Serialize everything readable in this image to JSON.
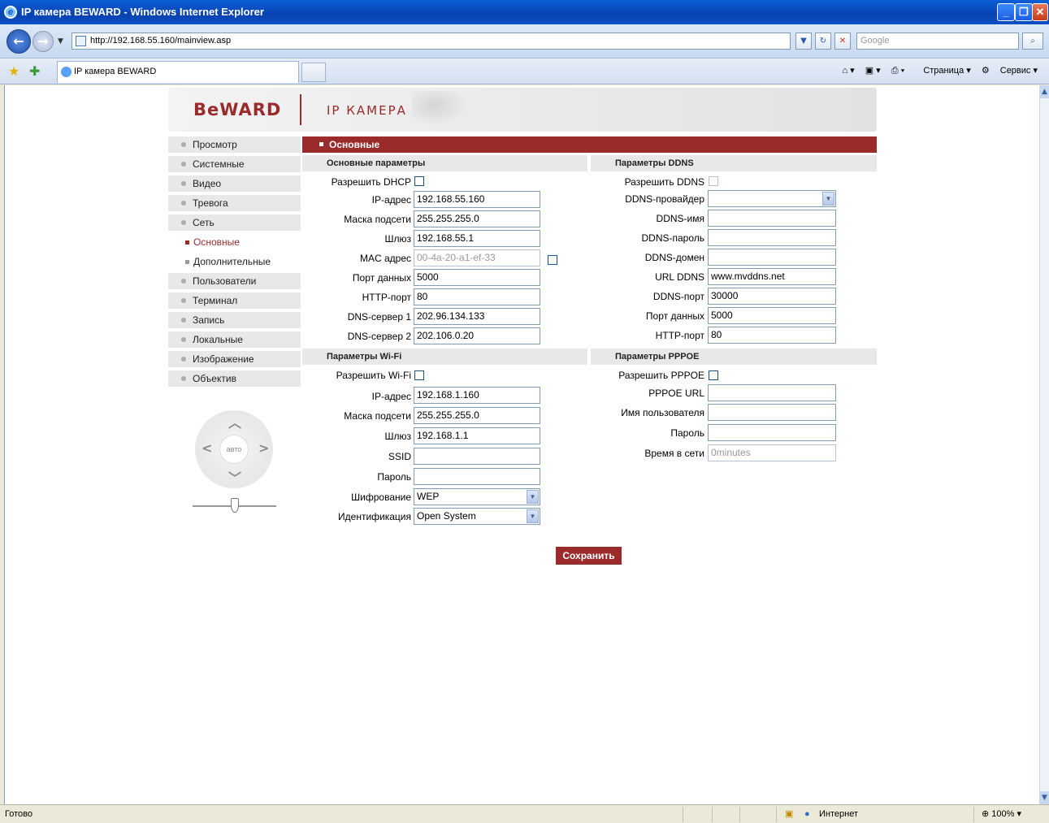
{
  "window": {
    "title": "IP камера BEWARD - Windows Internet Explorer",
    "url": "http://192.168.55.160/mainview.asp",
    "search_placeholder": "Google",
    "tab_title": "IP камера BEWARD",
    "toolbar": {
      "page": "Страница",
      "tools": "Сервис"
    }
  },
  "status": {
    "left": "Готово",
    "zone": "Интернет",
    "zoom": "100%"
  },
  "header": {
    "logo": "BeWARD",
    "product": "IP КАМЕРА"
  },
  "menu": [
    {
      "label": "Просмотр"
    },
    {
      "label": "Системные"
    },
    {
      "label": "Видео"
    },
    {
      "label": "Тревога"
    },
    {
      "label": "Сеть"
    },
    {
      "label": "Основные"
    },
    {
      "label": "Дополнительные"
    },
    {
      "label": "Пользователи"
    },
    {
      "label": "Терминал"
    },
    {
      "label": "Запись"
    },
    {
      "label": "Локальные"
    },
    {
      "label": "Изображение"
    },
    {
      "label": "Объектив"
    }
  ],
  "ptz": {
    "center": "авто"
  },
  "page_title": "Основные",
  "basic": {
    "title": "Основные параметры",
    "dhcp": "Разрешить DHCP",
    "ip_label": "IP-адрес",
    "ip": "192.168.55.160",
    "mask_label": "Маска подсети",
    "mask": "255.255.255.0",
    "gw_label": "Шлюз",
    "gw": "192.168.55.1",
    "mac_label": "MAC адрес",
    "mac": "00-4a-20-a1-ef-33",
    "port_label": "Порт данных",
    "port": "5000",
    "http_label": "HTTP-порт",
    "http": "80",
    "dns1_label": "DNS-сервер 1",
    "dns1": "202.96.134.133",
    "dns2_label": "DNS-сервер 2",
    "dns2": "202.106.0.20"
  },
  "ddns": {
    "title": "Параметры DDNS",
    "enable": "Разрешить DDNS",
    "provider_label": "DDNS-провайдер",
    "provider": "",
    "name_label": "DDNS-имя",
    "name": "",
    "pass_label": "DDNS-пароль",
    "pass": "",
    "domain_label": "DDNS-домен",
    "domain": "",
    "url_label": "URL DDNS",
    "url": "www.mvddns.net",
    "port_label": "DDNS-порт",
    "port": "30000",
    "data_label": "Порт данных",
    "data": "5000",
    "http_label": "HTTP-порт",
    "http": "80"
  },
  "wifi": {
    "title": "Параметры Wi-Fi",
    "enable": "Разрешить Wi-Fi",
    "ip_label": "IP-адрес",
    "ip": "192.168.1.160",
    "mask_label": "Маска подсети",
    "mask": "255.255.255.0",
    "gw_label": "Шлюз",
    "gw": "192.168.1.1",
    "ssid_label": "SSID",
    "ssid": "",
    "pass_label": "Пароль",
    "pass": "",
    "enc_label": "Шифрование",
    "enc": "WEP",
    "auth_label": "Идентификация",
    "auth": "Open System"
  },
  "pppoe": {
    "title": "Параметры PPPOE",
    "enable": "Разрешить PPPOE",
    "url_label": "PPPOE URL",
    "url": "",
    "user_label": "Имя пользователя",
    "user": "",
    "pass_label": "Пароль",
    "pass": "",
    "time_label": "Время в сети",
    "time": "0minutes"
  },
  "save_label": "Сохранить"
}
